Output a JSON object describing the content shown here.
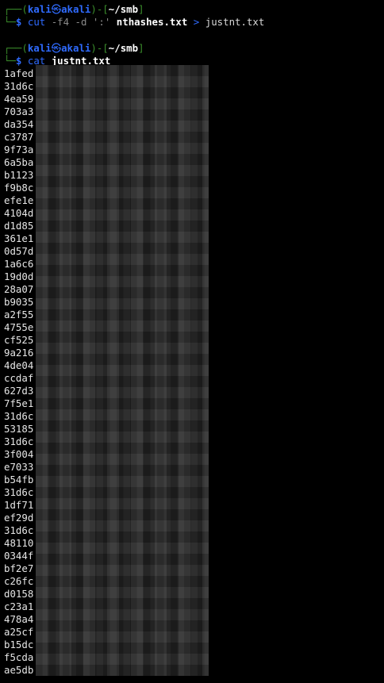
{
  "prompt1": {
    "frame_top": "┌──(",
    "user": "kali",
    "skull": "㉿",
    "host": "akali",
    "frame_mid": ")-[",
    "path": "~/smb",
    "frame_end": "]",
    "frame_bottom": "└─",
    "dollar": "$",
    "cmd": "cut",
    "args": "-f4 -d ':'",
    "file1": "nthashes.txt",
    "redirect": ">",
    "file2": "justnt.txt"
  },
  "prompt2": {
    "frame_top": "┌──(",
    "user": "kali",
    "skull": "㉿",
    "host": "akali",
    "frame_mid": ")-[",
    "path": "~/smb",
    "frame_end": "]",
    "frame_bottom": "└─",
    "dollar": "$",
    "cmd": "cat",
    "file": "justnt.txt"
  },
  "output": [
    "1afed",
    "31d6c",
    "4ea59",
    "703a3",
    "da354",
    "c3787",
    "9f73a",
    "6a5ba",
    "b1123",
    "f9b8c",
    "efe1e",
    "4104d",
    "d1d85",
    "361e1",
    "0d57d",
    "1a6c6",
    "19d0d",
    "28a07",
    "b9035",
    "a2f55",
    "4755e",
    "cf525",
    "9a216",
    "4de04",
    "ccdaf",
    "627d3",
    "7f5e1",
    "31d6c",
    "53185",
    "31d6c",
    "3f004",
    "e7033",
    "b54fb",
    "31d6c",
    "1df71",
    "ef29d",
    "31d6c",
    "48110",
    "0344f",
    "bf2e7",
    "c26fc",
    "d0158",
    "c23a1",
    "478a4",
    "a25cf",
    "b15dc",
    "f5cda",
    "ae5db"
  ],
  "colors": {
    "background": "#000000",
    "frame": "#3b8e2c",
    "user": "#2f6bff",
    "text": "#ffffff"
  }
}
